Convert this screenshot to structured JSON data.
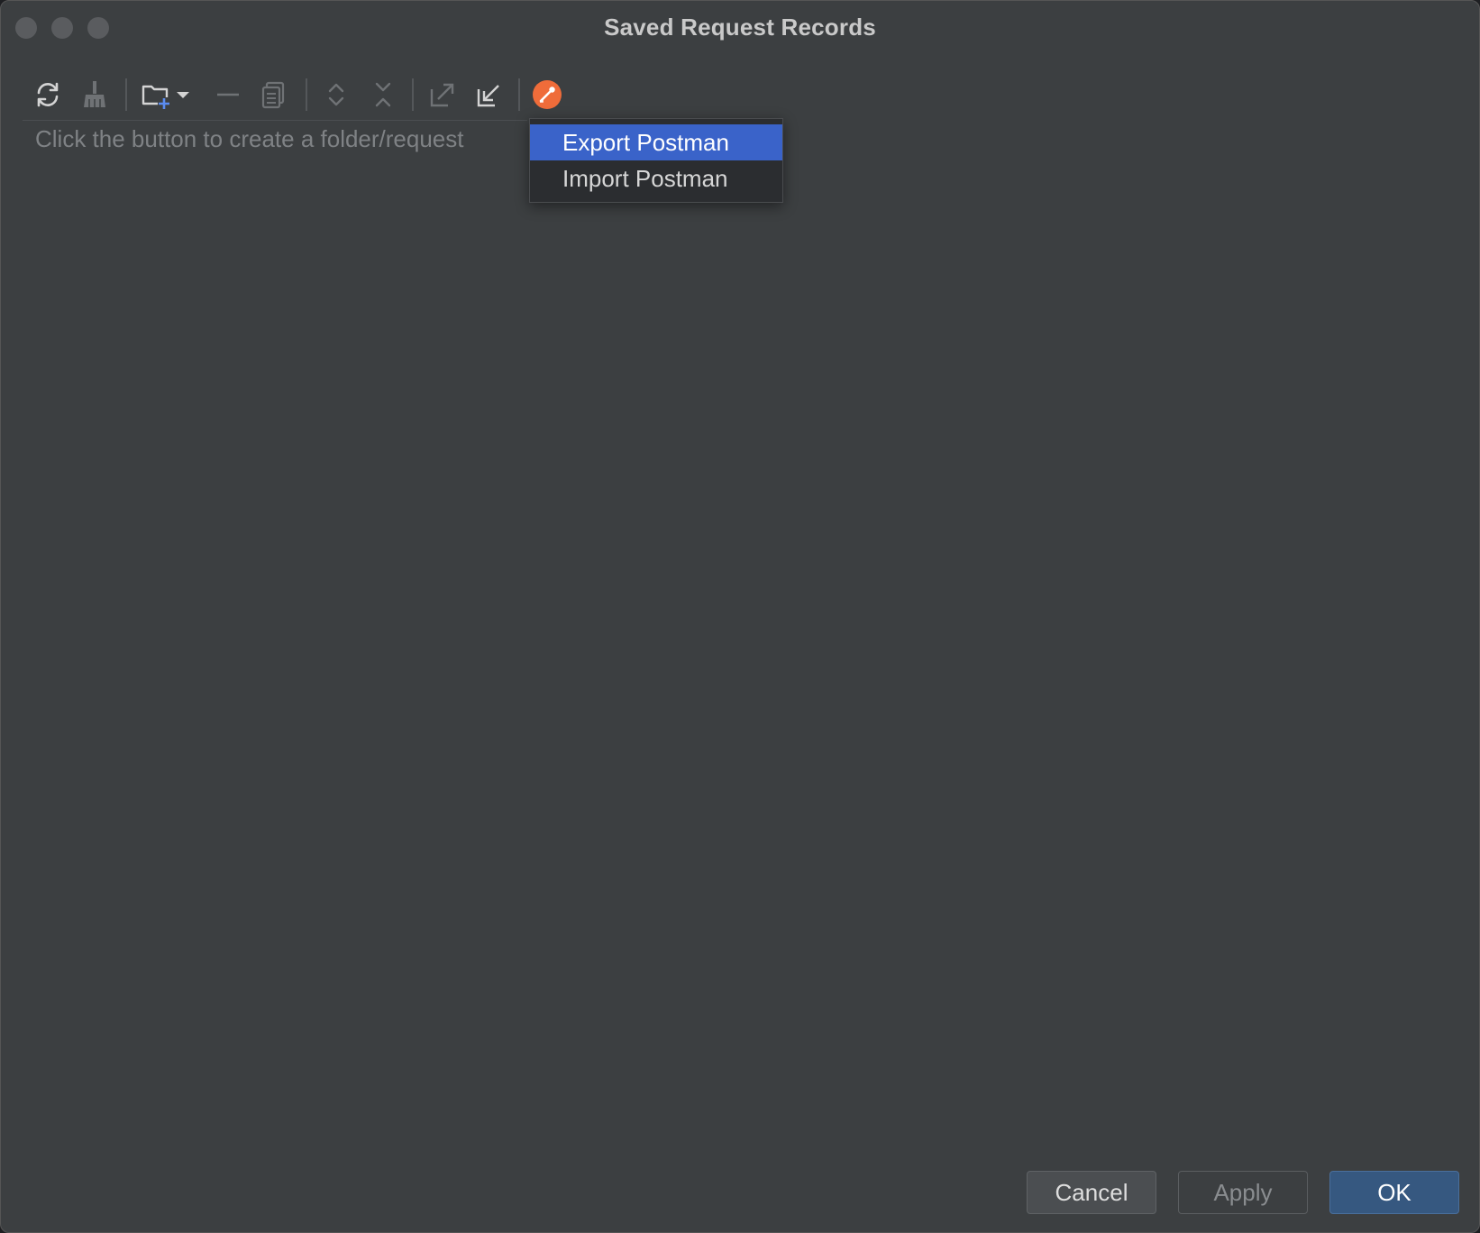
{
  "window": {
    "title": "Saved Request Records"
  },
  "toolbar": {
    "buttons": [
      {
        "name": "refresh-icon",
        "enabled": true
      },
      {
        "name": "clean-icon",
        "enabled": false
      },
      {
        "name": "new-folder-icon",
        "enabled": true
      },
      {
        "name": "chevron-down-icon",
        "enabled": true
      },
      {
        "name": "remove-icon",
        "enabled": false
      },
      {
        "name": "copy-icon",
        "enabled": false
      },
      {
        "name": "expand-all-icon",
        "enabled": false
      },
      {
        "name": "collapse-all-icon",
        "enabled": false
      },
      {
        "name": "export-icon",
        "enabled": false
      },
      {
        "name": "import-icon",
        "enabled": true
      },
      {
        "name": "postman-icon",
        "enabled": true
      }
    ],
    "postman_color": "#ef6c3a"
  },
  "tree": {
    "empty_text": "Click the button to create a folder/request"
  },
  "popup_menu": {
    "items": [
      {
        "label": "Export Postman",
        "selected": true
      },
      {
        "label": "Import Postman",
        "selected": false
      }
    ],
    "selected_color": "#3a63c9"
  },
  "footer": {
    "cancel_label": "Cancel",
    "apply_label": "Apply",
    "ok_label": "OK"
  }
}
